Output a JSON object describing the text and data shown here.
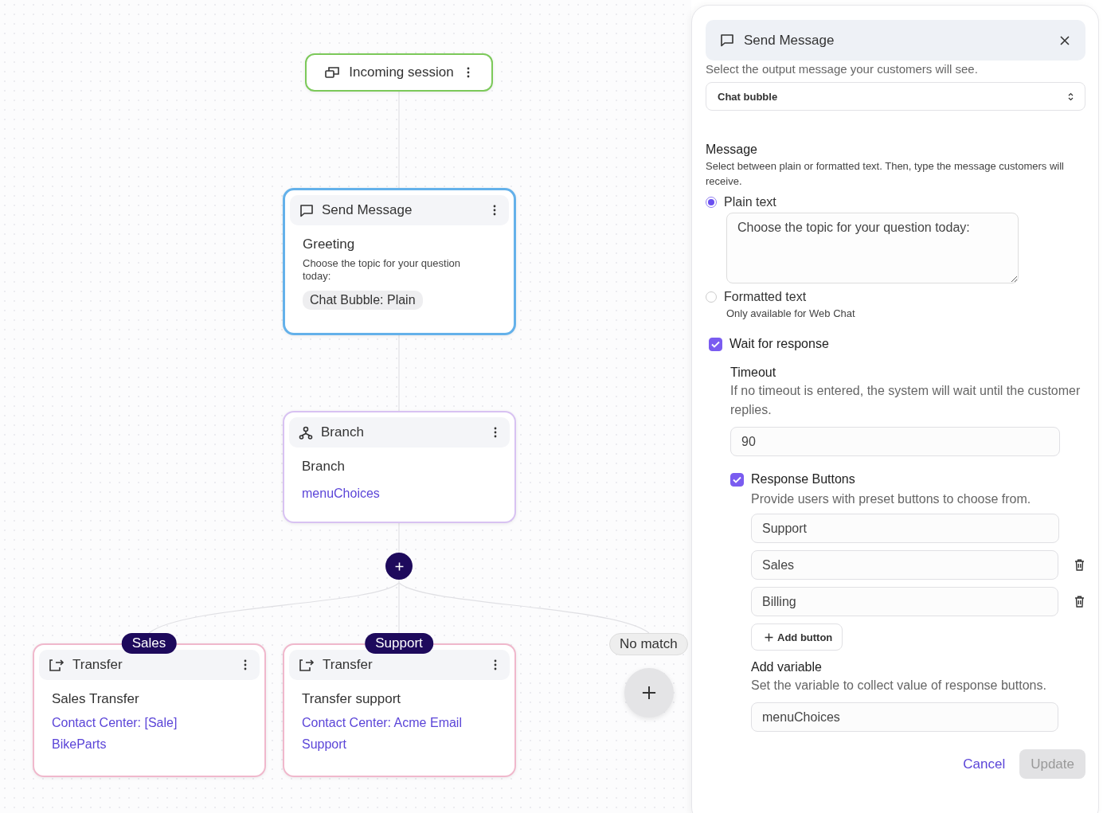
{
  "canvas": {
    "nodes": [
      {
        "kind": "trigger",
        "title": "Incoming session",
        "selected": false
      },
      {
        "kind": "message",
        "title": "Send Message",
        "selected": true,
        "name": "Greeting",
        "description": "Choose the topic for your question today:",
        "tag": "Chat Bubble: Plain"
      },
      {
        "kind": "branch",
        "title": "Branch",
        "selected": false,
        "name": "Branch",
        "link": "menuChoices"
      }
    ],
    "branches": [
      {
        "label": "Sales",
        "node": {
          "kind": "transfer",
          "title": "Transfer",
          "selected": false,
          "name": "Sales Transfer",
          "link": "Contact Center: [Sale] BikeParts"
        }
      },
      {
        "label": "Support",
        "node": {
          "kind": "transfer",
          "title": "Transfer",
          "selected": false,
          "name": "Transfer support",
          "link": "Contact Center: Acme Email Support"
        }
      }
    ],
    "no_match": {
      "label": "No match"
    }
  },
  "panel": {
    "title": "Send Message",
    "intro": "Select the output message your customers will see.",
    "output_select": {
      "value": "Chat bubble"
    },
    "message": {
      "heading": "Message",
      "description": "Select between plain or formatted text. Then, type the message customers will receive.",
      "options": [
        {
          "label": "Plain text",
          "selected": true,
          "value": "Choose the topic for your question today:"
        },
        {
          "label": "Formatted text",
          "selected": false,
          "note": "Only available for Web Chat"
        }
      ]
    },
    "wait_for_response": {
      "label": "Wait for response",
      "checked": true
    },
    "timeout": {
      "heading": "Timeout",
      "description": "If no timeout is entered, the system will wait until the customer replies.",
      "value": "90"
    },
    "response_buttons": {
      "label": "Response Buttons",
      "checked": true,
      "description": "Provide users with preset buttons to choose from.",
      "options": [
        {
          "value": "Support",
          "deletable": false
        },
        {
          "value": "Sales",
          "deletable": true
        },
        {
          "value": "Billing",
          "deletable": true
        }
      ],
      "add_label": "Add button"
    },
    "variable": {
      "heading": "Add variable",
      "description": "Set the variable to collect value of response buttons.",
      "value": "menuChoices"
    },
    "buttons": {
      "cancel": "Cancel",
      "update": {
        "label": "Update",
        "disabled": true
      }
    }
  }
}
